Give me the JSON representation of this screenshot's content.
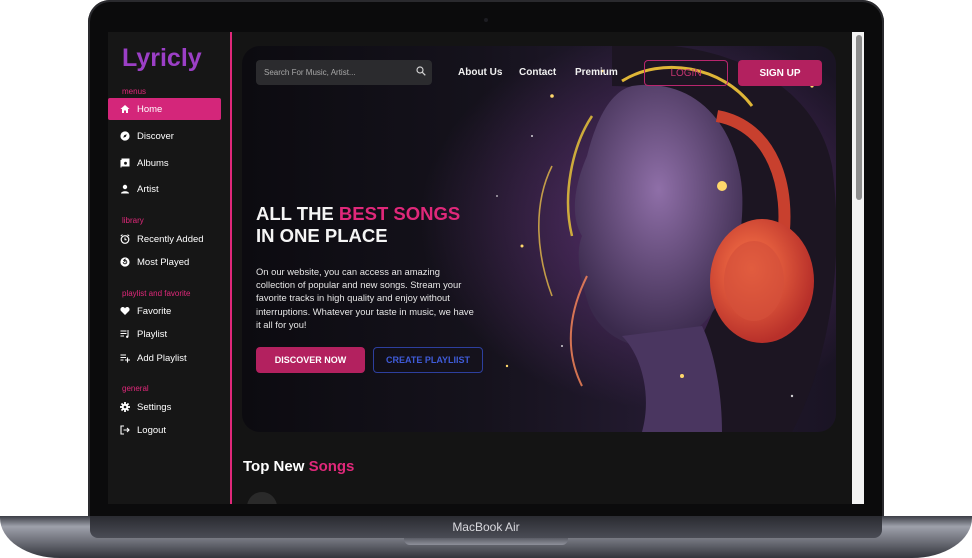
{
  "device": {
    "label": "MacBook Air"
  },
  "app": {
    "logo": "Lyricly"
  },
  "sidebar": {
    "sections": [
      {
        "label": "menus",
        "items": [
          {
            "label": "Home",
            "icon": "home-icon",
            "active": true
          },
          {
            "label": "Discover",
            "icon": "compass-icon"
          },
          {
            "label": "Albums",
            "icon": "album-icon"
          },
          {
            "label": "Artist",
            "icon": "user-icon"
          }
        ]
      },
      {
        "label": "library",
        "items": [
          {
            "label": "Recently Added",
            "icon": "alarm-clock-icon"
          },
          {
            "label": "Most Played",
            "icon": "replay-icon"
          }
        ]
      },
      {
        "label": "playlist and favorite",
        "items": [
          {
            "label": "Favorite",
            "icon": "heart-icon"
          },
          {
            "label": "Playlist",
            "icon": "playlist-icon"
          },
          {
            "label": "Add Playlist",
            "icon": "playlist-add-icon"
          }
        ]
      },
      {
        "label": "general",
        "items": [
          {
            "label": "Settings",
            "icon": "gear-icon"
          },
          {
            "label": "Logout",
            "icon": "logout-icon"
          }
        ]
      }
    ]
  },
  "header": {
    "search_placeholder": "Search For Music, Artist...",
    "links": [
      "About Us",
      "Contact",
      "Premium"
    ],
    "login": "LOGIN",
    "signup": "SIGN UP"
  },
  "hero": {
    "title_line1_prefix": "ALL THE ",
    "title_line1_accent": "BEST SONGS",
    "title_line2": "IN ONE PLACE",
    "description": "On our website, you can access an amazing collection of popular and new songs. Stream your favorite tracks in high quality and enjoy without interruptions. Whatever your taste in music, we have it all for you!",
    "discover_button": "DISCOVER NOW",
    "create_button": "CREATE PLAYLIIST"
  },
  "top_new": {
    "title_prefix": "Top New ",
    "title_accent": "Songs"
  },
  "colors": {
    "accent_pink": "#e0287a",
    "button_pink": "#b3215f",
    "logo_purple": "#9b3fc6",
    "outline_blue": "#3f5bd8",
    "background": "#141414"
  }
}
